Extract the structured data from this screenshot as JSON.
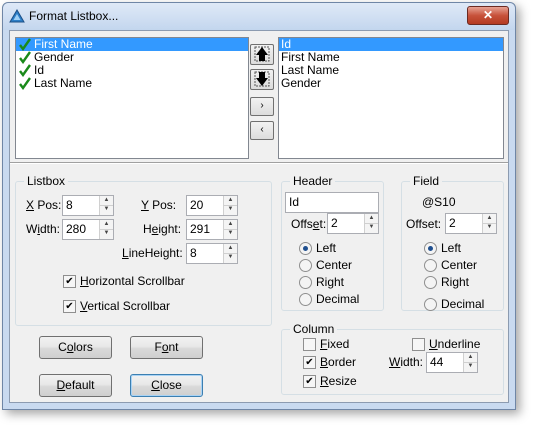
{
  "window": {
    "title": "Format Listbox...",
    "close_glyph": "✕"
  },
  "left_list": {
    "items": [
      "First Name",
      "Gender",
      "Id",
      "Last Name"
    ],
    "selected": "First Name"
  },
  "right_list": {
    "items": [
      "Id",
      "First Name",
      "Last Name",
      "Gender"
    ],
    "selected": "Id"
  },
  "mid_buttons": {
    "right_glyph": "›",
    "left_glyph": "‹"
  },
  "listbox": {
    "group_label": "Listbox",
    "xpos": {
      "label_pre": "",
      "label_u": "X",
      "label_post": " Pos:",
      "value": "8"
    },
    "ypos": {
      "label_pre": "",
      "label_u": "Y",
      "label_post": " Pos:",
      "value": "20"
    },
    "width": {
      "label_pre": "W",
      "label_u": "i",
      "label_post": "dth:",
      "value": "280"
    },
    "height": {
      "label_pre": "H",
      "label_u": "e",
      "label_post": "ight:",
      "value": "291"
    },
    "lineheight": {
      "label_pre": "",
      "label_u": "L",
      "label_post": "ineHeight:",
      "value": "8"
    },
    "hscroll": {
      "label_pre": "",
      "label_u": "H",
      "label_post": "orizontal Scrollbar",
      "checked": true
    },
    "vscroll": {
      "label_pre": "",
      "label_u": "V",
      "label_post": "ertical Scrollbar",
      "checked": true
    }
  },
  "header": {
    "group_label": "Header",
    "text_value": "Id",
    "offset_label_pre": "Offs",
    "offset_label_u": "e",
    "offset_label_post": "t:",
    "offset_value": "2",
    "align": [
      "Left",
      "Center",
      "Right",
      "Decimal"
    ],
    "selected": "Left"
  },
  "field": {
    "group_label": "Field",
    "format_value": "@S10",
    "offset_label": "Offset:",
    "offset_value": "2",
    "align": [
      "Left",
      "Center",
      "Right",
      "Decimal"
    ],
    "selected": "Left"
  },
  "column": {
    "group_label": "Column",
    "fixed": {
      "label_pre": "",
      "label_u": "F",
      "label_post": "ixed",
      "checked": false
    },
    "border": {
      "label_pre": "",
      "label_u": "B",
      "label_post": "order",
      "checked": true
    },
    "resize": {
      "label_pre": "",
      "label_u": "R",
      "label_post": "esize",
      "checked": true
    },
    "underline": {
      "label_pre": "",
      "label_u": "U",
      "label_post": "nderline",
      "checked": false
    },
    "width": {
      "label_pre": "",
      "label_u": "W",
      "label_post": "idth:",
      "value": "44"
    }
  },
  "buttons": {
    "colors": {
      "pre": "C",
      "u": "o",
      "post": "lors"
    },
    "font": {
      "pre": "F",
      "u": "o",
      "post": "nt"
    },
    "default": {
      "pre": "",
      "u": "D",
      "post": "efault"
    },
    "close": {
      "pre": "",
      "u": "C",
      "post": "lose"
    }
  },
  "colors": {
    "selection": "#3399ff",
    "check": "#1a8a1a",
    "close_button": "#c7523b"
  }
}
